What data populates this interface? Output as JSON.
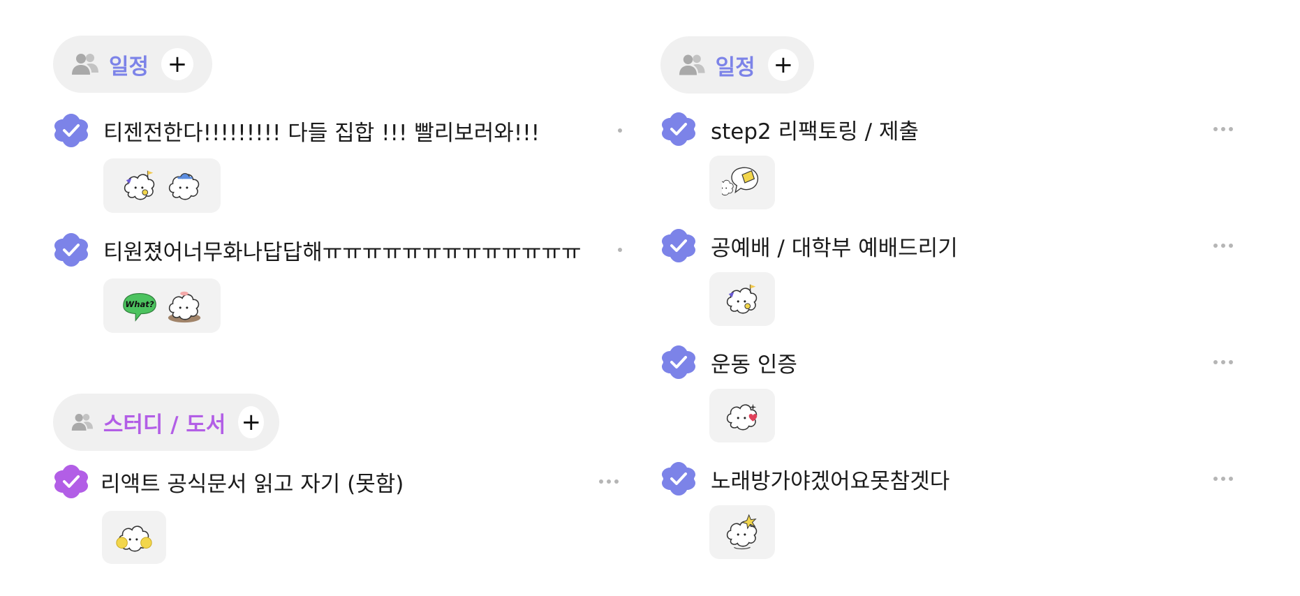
{
  "left": {
    "groups": [
      {
        "label": "일정",
        "color": "#7c83e8",
        "tasks": [
          {
            "title": "티젠전한다!!!!!!!!! 다들 집합 !!! 빨리보러와!!!",
            "stickers": [
              "flag-cloud-sticker",
              "hat-cloud-sticker"
            ]
          },
          {
            "title": "티원졌어너무화나답답해ㅠㅠㅠㅠㅠㅠㅠㅠㅠㅠㅠㅠㅠ",
            "stickers": [
              "what-bubble-sticker",
              "sad-cloud-sticker"
            ]
          }
        ]
      },
      {
        "label": "스터디 / 도서",
        "color": "#b25ee6",
        "tasks": [
          {
            "title": "리액트 공식문서 읽고 자기 (못함)",
            "stickers": [
              "cheer-cloud-sticker"
            ]
          }
        ]
      }
    ]
  },
  "right": {
    "groups": [
      {
        "label": "일정",
        "color": "#7c83e8",
        "tasks": [
          {
            "title": "step2 리팩토링 / 제출",
            "stickers": [
              "hand-bubble-sticker"
            ]
          },
          {
            "title": "공예배 / 대학부 예배드리기",
            "stickers": [
              "flag-cloud-sticker"
            ]
          },
          {
            "title": "운동 인증",
            "stickers": [
              "heart-cloud-sticker"
            ]
          },
          {
            "title": "노래방가야겠어요못참겟다",
            "stickers": [
              "sparkle-cloud-sticker"
            ]
          }
        ]
      }
    ]
  },
  "icons": {
    "people": "people-icon",
    "plus": "plus-icon",
    "check": "checkmark-icon",
    "more": "more-icon"
  }
}
